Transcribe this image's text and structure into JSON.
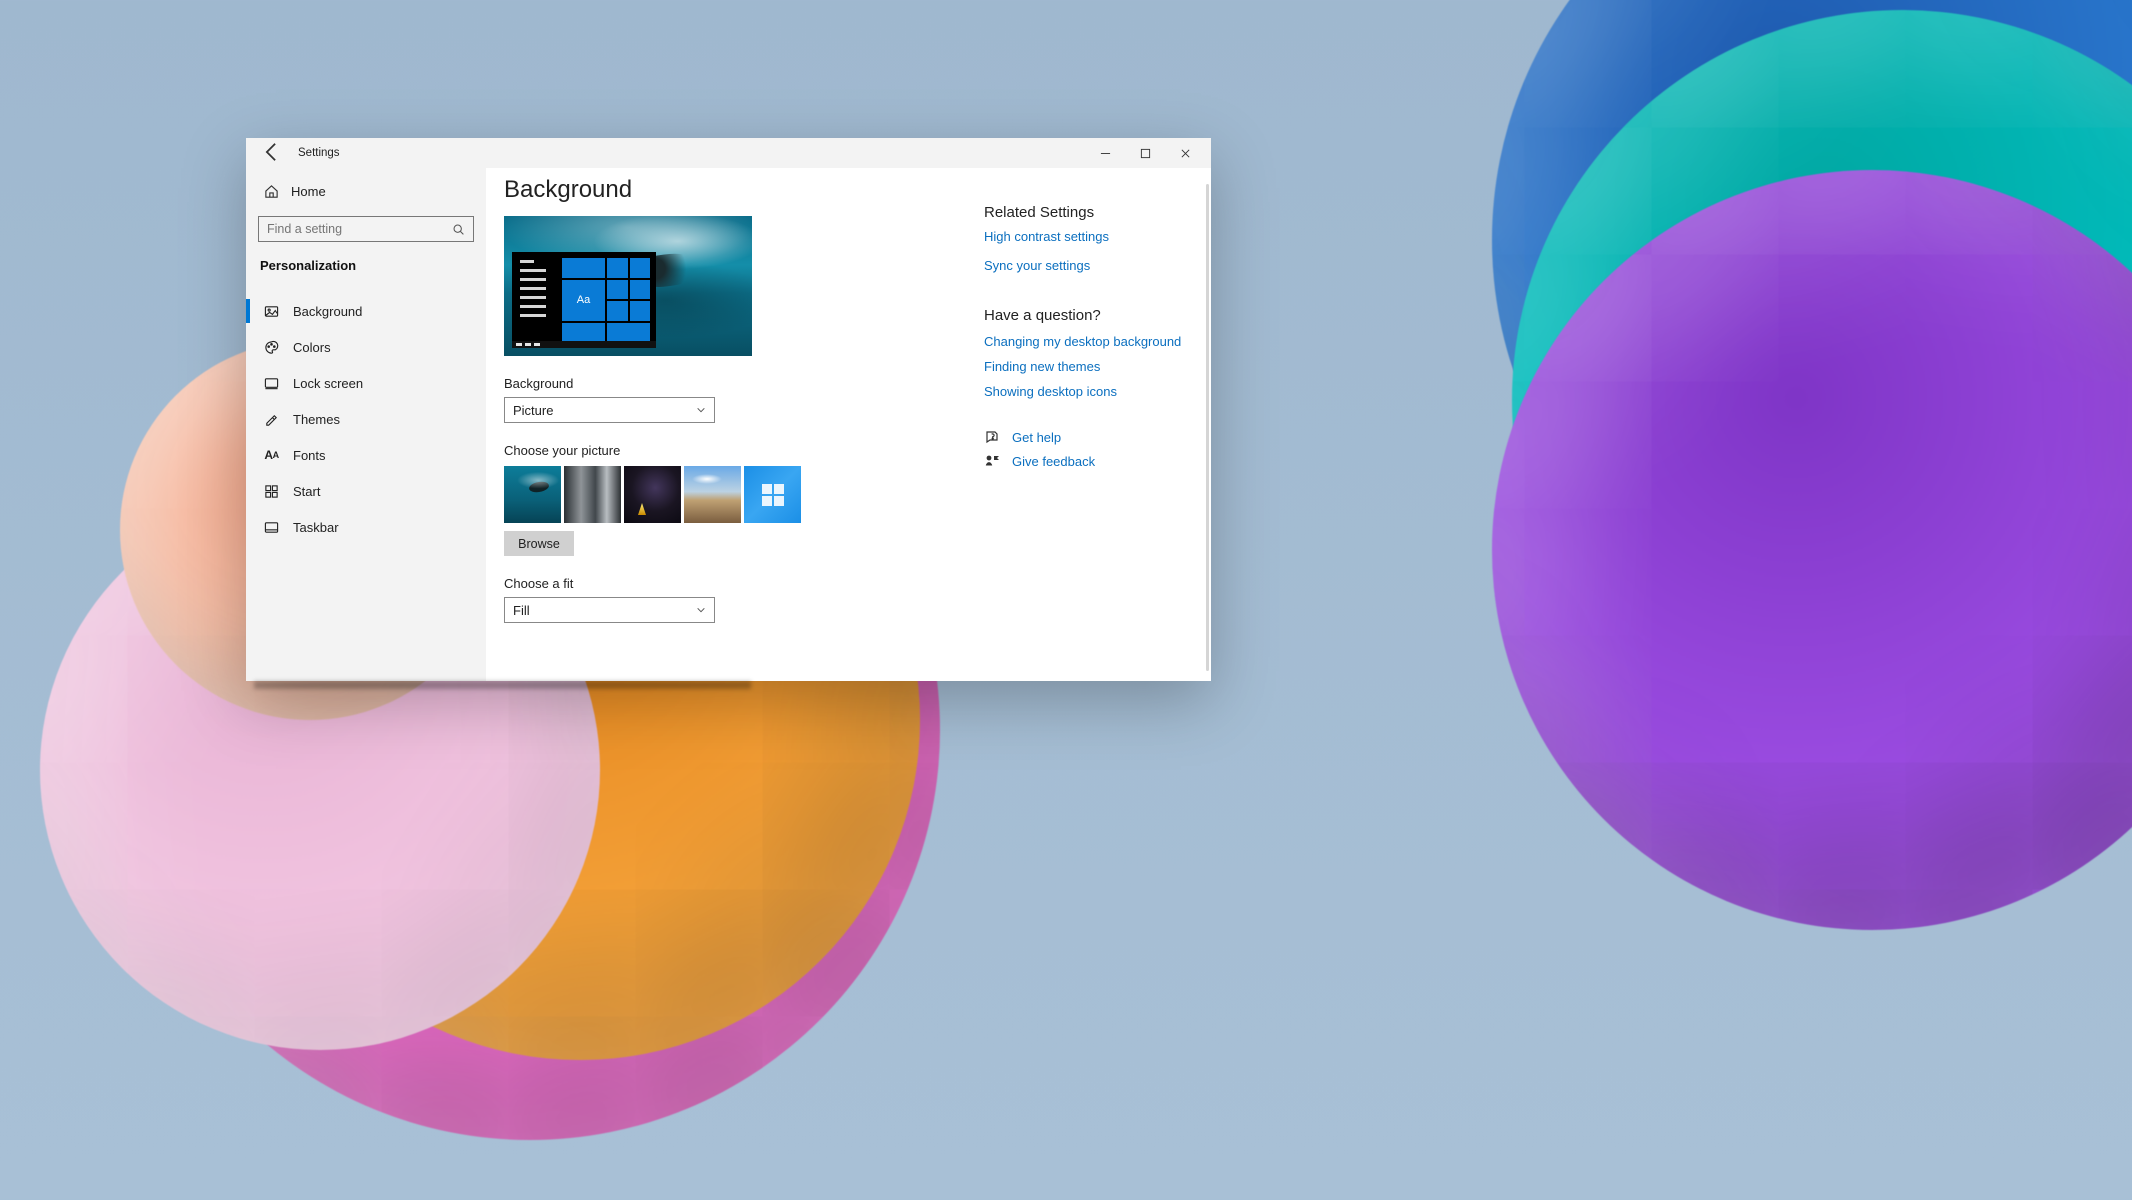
{
  "titlebar": {
    "app_title": "Settings"
  },
  "sidebar": {
    "home_label": "Home",
    "search_placeholder": "Find a setting",
    "category_label": "Personalization",
    "items": [
      {
        "label": "Background",
        "selected": true
      },
      {
        "label": "Colors"
      },
      {
        "label": "Lock screen"
      },
      {
        "label": "Themes"
      },
      {
        "label": "Fonts"
      },
      {
        "label": "Start"
      },
      {
        "label": "Taskbar"
      }
    ]
  },
  "page": {
    "title": "Background",
    "preview_tile_text": "Aa",
    "background_label": "Background",
    "background_value": "Picture",
    "choose_picture_label": "Choose your picture",
    "browse_label": "Browse",
    "choose_fit_label": "Choose a fit",
    "fit_value": "Fill"
  },
  "side": {
    "related_heading": "Related Settings",
    "links_related": [
      "High contrast settings",
      "Sync your settings"
    ],
    "question_heading": "Have a question?",
    "links_help": [
      "Changing my desktop background",
      "Finding new themes",
      "Showing desktop icons"
    ],
    "get_help_label": "Get help",
    "give_feedback_label": "Give feedback"
  }
}
